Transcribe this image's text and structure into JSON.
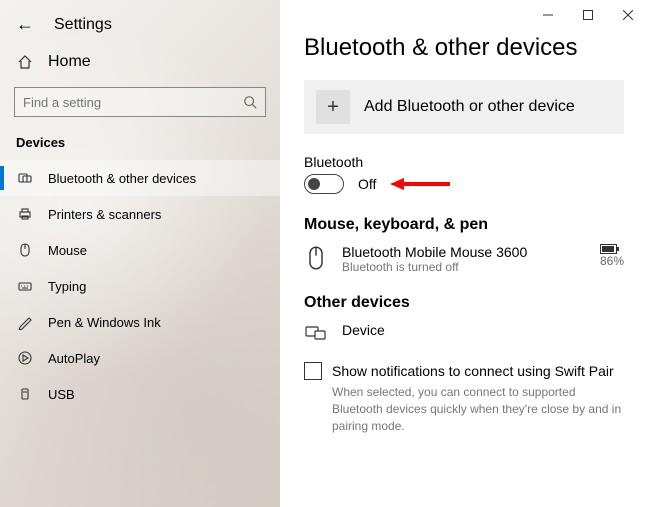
{
  "app_title": "Settings",
  "home_label": "Home",
  "search_placeholder": "Find a setting",
  "section_label": "Devices",
  "nav": [
    {
      "label": "Bluetooth & other devices"
    },
    {
      "label": "Printers & scanners"
    },
    {
      "label": "Mouse"
    },
    {
      "label": "Typing"
    },
    {
      "label": "Pen & Windows Ink"
    },
    {
      "label": "AutoPlay"
    },
    {
      "label": "USB"
    }
  ],
  "page_title": "Bluetooth & other devices",
  "add_device_label": "Add Bluetooth or other device",
  "bluetooth_label": "Bluetooth",
  "bluetooth_state": "Off",
  "section_mouse": "Mouse, keyboard, & pen",
  "device1": {
    "name": "Bluetooth Mobile Mouse 3600",
    "sub": "Bluetooth is turned off",
    "battery": "86%"
  },
  "section_other": "Other devices",
  "device2": {
    "name": "Device"
  },
  "swift_pair_label": "Show notifications to connect using Swift Pair",
  "swift_pair_help": "When selected, you can connect to supported Bluetooth devices quickly when they're close by and in pairing mode."
}
